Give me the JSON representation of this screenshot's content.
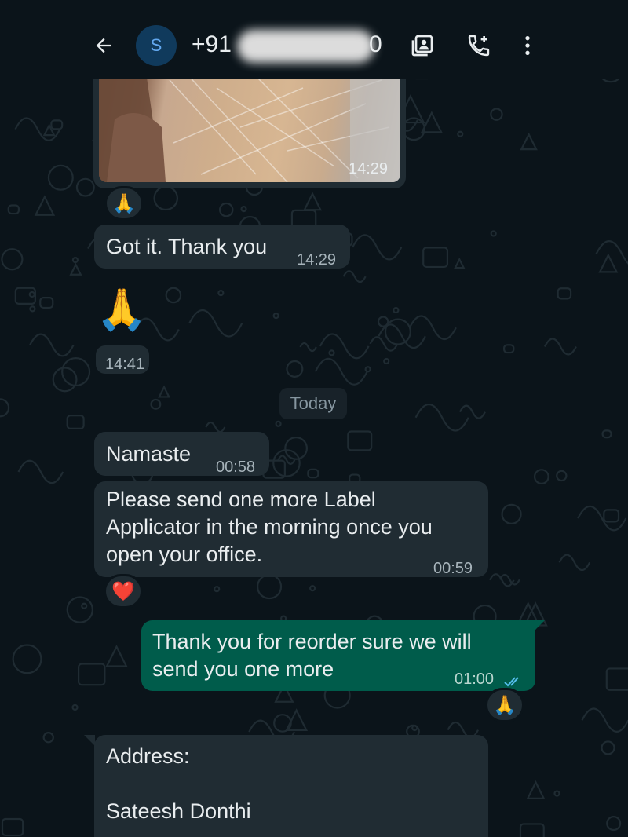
{
  "header": {
    "avatar_letter": "S",
    "contact_name": "+91",
    "contact_tail": "0",
    "icons": [
      "back-arrow-icon",
      "contact-card-icon",
      "add-call-icon",
      "more-vertical-icon"
    ]
  },
  "messages": [
    {
      "kind": "image",
      "time": "14:29",
      "reaction": "🙏"
    },
    {
      "kind": "text",
      "text": "Got it. Thank you",
      "time": "14:29"
    },
    {
      "kind": "emoji",
      "text": "🙏",
      "time": "14:41"
    },
    {
      "kind": "text",
      "text": "Namaste",
      "time": "00:58"
    },
    {
      "kind": "text",
      "lines": [
        "Please send one more Label",
        "Applicator in the morning once you",
        "open your office."
      ],
      "time": "00:59",
      "reaction": "❤️"
    },
    {
      "kind": "out",
      "lines": [
        "Thank you for reorder sure we will",
        "send you one more"
      ],
      "time": "01:00",
      "reaction": "🙏",
      "status": "read"
    },
    {
      "kind": "text",
      "lines": [
        "Address:",
        "",
        "Sateesh Donthi"
      ]
    }
  ],
  "date_divider": "Today",
  "colors": {
    "background": "#0b141a",
    "incoming_bubble": "#202c33",
    "outgoing_bubble": "#005c4b",
    "read_ticks": "#53bdeb",
    "avatar_bg": "#103a5c"
  }
}
